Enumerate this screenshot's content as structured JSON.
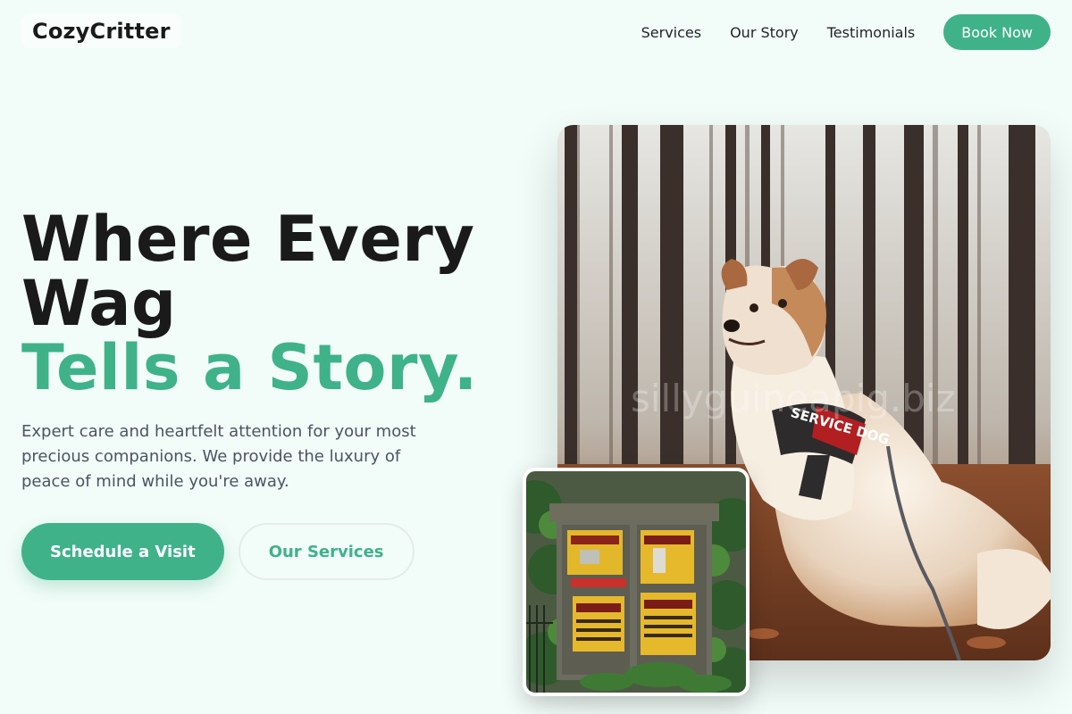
{
  "brand": {
    "name": "CozyCritter"
  },
  "nav": {
    "links": [
      "Services",
      "Our Story",
      "Testimonials"
    ],
    "cta_label": "Book Now"
  },
  "hero": {
    "title_line1": "Where Every",
    "title_line2": "Wag",
    "title_accent": "Tells a Story.",
    "subtitle": "Expert care and heartfelt attention for your most precious companions. We provide the luxury of peace of mind while you're away.",
    "primary_cta": "Schedule a Visit",
    "secondary_cta": "Our Services"
  },
  "images": {
    "main": {
      "subject": "dog-in-autumn-forest",
      "harness_text": "SERVICE DOG",
      "watermark": "sillyguineapig.biz"
    },
    "small": {
      "subject": "wall-mounted-mailboxes-with-posters"
    }
  },
  "colors": {
    "accent": "#3fb28a",
    "background": "#f2fcf8",
    "heading": "#1a1a1a",
    "body_text": "#4a5560"
  }
}
